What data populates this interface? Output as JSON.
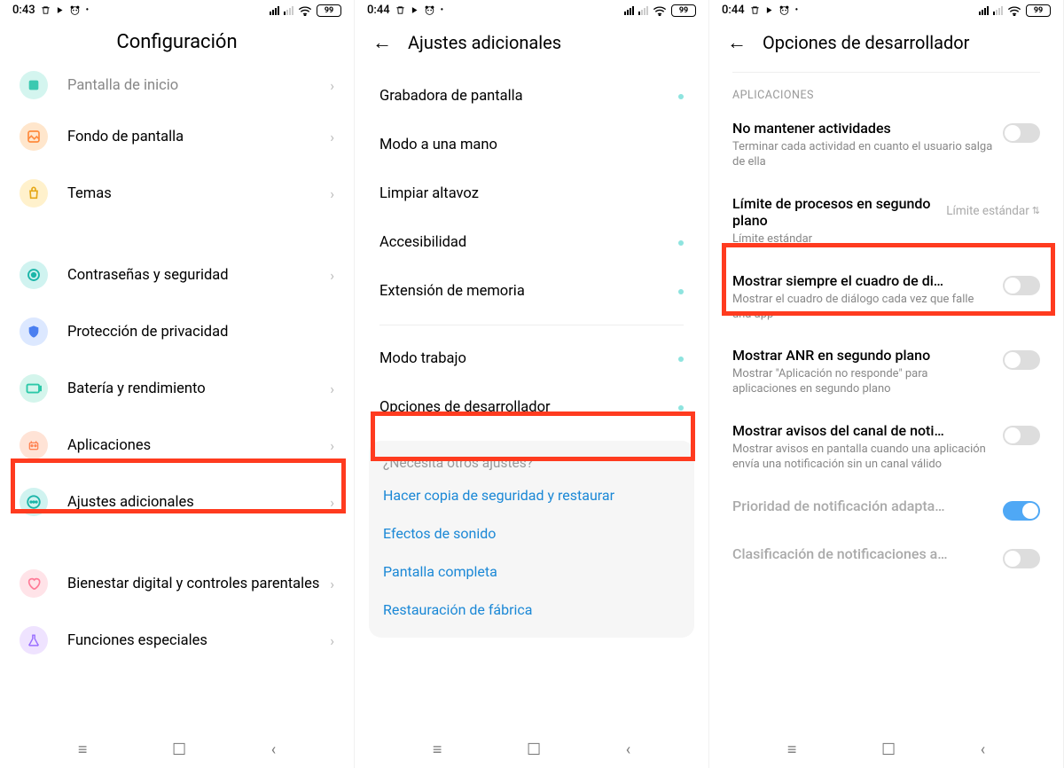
{
  "status": {
    "time1": "0:43",
    "time2": "0:44",
    "time3": "0:44",
    "battery": "99"
  },
  "screen1": {
    "title": "Configuración",
    "items": [
      {
        "label": "Pantalla de inicio",
        "color": "#8ee4df",
        "shape": "square",
        "cut": true
      },
      {
        "label": "Fondo de pantalla",
        "color": "#fcd6a8",
        "shape": "gallery"
      },
      {
        "label": "Temas",
        "color": "#fde9a8",
        "shape": "bag"
      }
    ],
    "items2": [
      {
        "label": "Contraseñas y seguridad",
        "color": "#a8ece7",
        "shape": "target"
      },
      {
        "label": "Protección de privacidad",
        "color": "#b8d9ff",
        "shape": "shield"
      },
      {
        "label": "Batería y rendimiento",
        "color": "#b8f0e8",
        "shape": "battery"
      },
      {
        "label": "Aplicaciones",
        "color": "#ffd6c4",
        "shape": "robot"
      },
      {
        "label": "Ajustes adicionales",
        "color": "#b8f0ec",
        "shape": "dots"
      }
    ],
    "items3": [
      {
        "label": "Bienestar digital y controles parentales",
        "color": "#ffd6dc",
        "shape": "heart"
      },
      {
        "label": "Funciones especiales",
        "color": "#e6d6ff",
        "shape": "flask"
      }
    ]
  },
  "screen2": {
    "title": "Ajustes adicionales",
    "items": [
      {
        "label": "Grabadora de pantalla",
        "dot": true
      },
      {
        "label": "Modo a una mano"
      },
      {
        "label": "Limpiar altavoz"
      },
      {
        "label": "Accesibilidad",
        "dot": true
      },
      {
        "label": "Extensión de memoria",
        "dot": true
      }
    ],
    "items2": [
      {
        "label": "Modo trabajo",
        "dot": true
      },
      {
        "label": "Opciones de desarrollador",
        "dot": true
      }
    ],
    "footer": {
      "question": "¿Necesita otros ajustes?",
      "links": [
        "Hacer copia de seguridad y restaurar",
        "Efectos de sonido",
        "Pantalla completa",
        "Restauración de fábrica"
      ]
    }
  },
  "screen3": {
    "title": "Opciones de desarrollador",
    "section": "APLICACIONES",
    "items": [
      {
        "title": "No mantener actividades",
        "sub": "Terminar cada actividad en cuanto el usuario salga de ella",
        "toggle": false
      },
      {
        "title": "Límite de procesos en segundo plano",
        "sub": "Límite estándar",
        "select": "Límite estándar",
        "highlight": true
      },
      {
        "title": "Mostrar siempre el cuadro de di…",
        "sub": "Mostrar el cuadro de diálogo cada vez que falle una app",
        "toggle": false
      },
      {
        "title": "Mostrar ANR en segundo plano",
        "sub": "Mostrar \"Aplicación no responde\" para aplicaciones en segundo plano",
        "toggle": false
      },
      {
        "title": "Mostrar avisos del canal de noti…",
        "sub": "Mostrar avisos en pantalla cuando una aplicación envía una notificación sin un canal válido",
        "toggle": false
      },
      {
        "title": "Prioridad de notificación adapta…",
        "toggle": true,
        "dim": true
      },
      {
        "title": "Clasificación de notificaciones a…",
        "toggle": false,
        "dim": true
      }
    ]
  }
}
